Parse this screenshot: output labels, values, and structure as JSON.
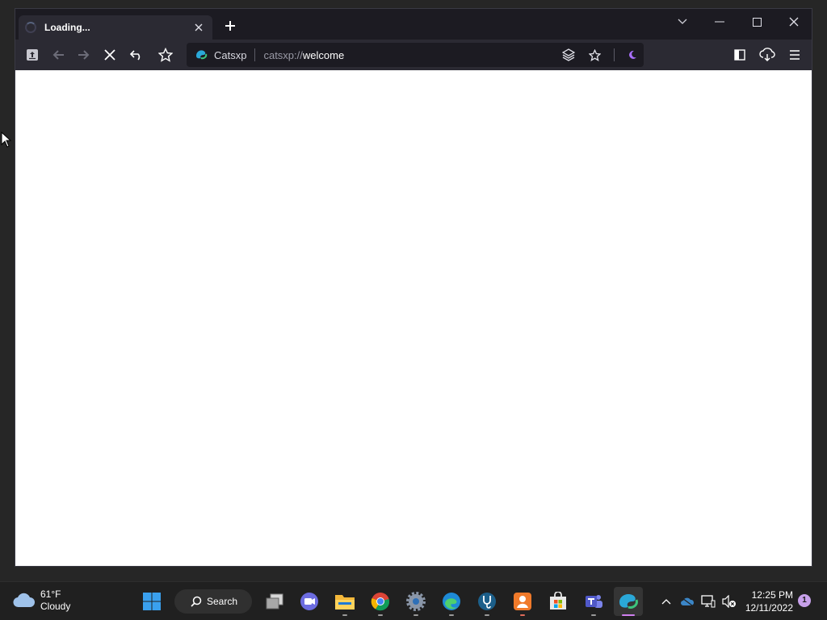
{
  "browser": {
    "tab": {
      "title": "Loading...",
      "close_icon": "close-icon",
      "loading_icon": "spinner-icon"
    },
    "new_tab_icon": "plus-icon",
    "window_controls": [
      "chevron-down-icon",
      "minimize-icon",
      "maximize-icon",
      "close-icon"
    ],
    "toolbar": {
      "left_icons": [
        "sidebar-upload-icon",
        "back-arrow-icon",
        "forward-arrow-icon",
        "stop-loading-icon",
        "undo-icon",
        "bookmark-star-icon"
      ],
      "right_icons": [
        "sidebar-toggle-icon",
        "download-cloud-icon",
        "menu-icon"
      ]
    },
    "urlbar": {
      "site_name": "Catsxp",
      "scheme": "catsxp://",
      "host": "welcome",
      "right_icons": [
        "layers-icon",
        "star-icon",
        "night-mode-icon"
      ]
    }
  },
  "taskbar": {
    "weather": {
      "temperature": "61°F",
      "condition": "Cloudy"
    },
    "search_label": "Search",
    "apps": [
      {
        "name": "start-button",
        "icon": "windows-logo-icon"
      },
      {
        "name": "task-view",
        "icon": "task-view-icon"
      },
      {
        "name": "chat",
        "icon": "chat-camera-icon"
      },
      {
        "name": "file-explorer",
        "icon": "folder-icon"
      },
      {
        "name": "chrome",
        "icon": "chrome-icon"
      },
      {
        "name": "settings",
        "icon": "gear-icon"
      },
      {
        "name": "edge",
        "icon": "edge-icon"
      },
      {
        "name": "app-stethoscope",
        "icon": "stethoscope-icon"
      },
      {
        "name": "app-orange",
        "icon": "orange-app-icon"
      },
      {
        "name": "store",
        "icon": "store-icon"
      },
      {
        "name": "teams",
        "icon": "teams-icon"
      },
      {
        "name": "catsxp",
        "icon": "catsxp-icon"
      }
    ],
    "tray_icons": [
      "chevron-up-icon",
      "onedrive-icon",
      "network-icon",
      "volume-muted-icon"
    ],
    "clock": {
      "time": "12:25 PM",
      "date": "12/11/2022"
    },
    "notification_count": "1"
  },
  "colors": {
    "taskbar_bg": "#202020",
    "browser_bg": "#1c1b22",
    "toolbar_bg": "#2b2a33",
    "accent": "#a970ff"
  }
}
